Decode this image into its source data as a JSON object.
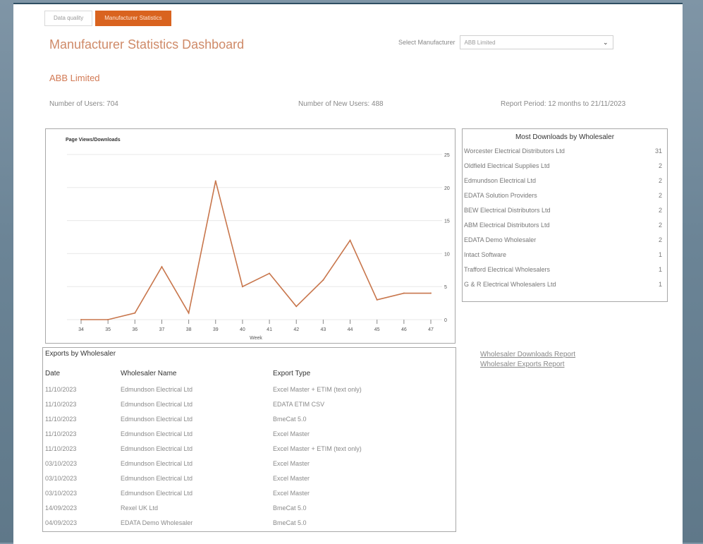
{
  "tabs": [
    {
      "label": "Data quality",
      "active": false
    },
    {
      "label": "Manufacturer Statistics",
      "active": true
    }
  ],
  "header": {
    "title": "Manufacturer Statistics Dashboard",
    "select_label": "Select Manufacturer",
    "select_value": "ABB Limited"
  },
  "manufacturer": "ABB Limited",
  "stats": {
    "users": "Number of Users: 704",
    "new_users": "Number of New Users: 488",
    "period": "Report Period: 12 months to 21/11/2023"
  },
  "chart_data": {
    "type": "line",
    "title": "Page Views/Downloads",
    "xlabel": "Week",
    "ylabel": "",
    "x": [
      "34",
      "35",
      "36",
      "37",
      "38",
      "39",
      "40",
      "41",
      "42",
      "43",
      "44",
      "45",
      "46",
      "47"
    ],
    "values": [
      0,
      0,
      1,
      8,
      1,
      21,
      5,
      7,
      2,
      6,
      12,
      3,
      4,
      4
    ],
    "ylim": [
      0,
      25
    ],
    "yticks": [
      0,
      5,
      10,
      15,
      20,
      25
    ],
    "y_axis_side": "right",
    "line_color": "#c8764c",
    "grid": true
  },
  "downloads": {
    "title": "Most Downloads by Wholesaler",
    "rows": [
      {
        "name": "Worcester Electrical Distributors Ltd",
        "count": "31"
      },
      {
        "name": "Oldfield Electrical Supplies Ltd",
        "count": "2"
      },
      {
        "name": "Edmundson Electrical Ltd",
        "count": "2"
      },
      {
        "name": "EDATA Solution Providers",
        "count": "2"
      },
      {
        "name": "BEW Electrical Distributors Ltd",
        "count": "2"
      },
      {
        "name": "ABM Electrical Distributors Ltd",
        "count": "2"
      },
      {
        "name": "EDATA Demo Wholesaler",
        "count": "2"
      },
      {
        "name": "Intact Software",
        "count": "1"
      },
      {
        "name": "Trafford Electrical Wholesalers",
        "count": "1"
      },
      {
        "name": "G & R Electrical Wholesalers Ltd",
        "count": "1"
      }
    ]
  },
  "exports": {
    "title": "Exports by Wholesaler",
    "headers": [
      "Date",
      "Wholesaler Name",
      "Export Type"
    ],
    "rows": [
      [
        "11/10/2023",
        "Edmundson Electrical Ltd",
        "Excel Master + ETIM (text only)"
      ],
      [
        "11/10/2023",
        "Edmundson Electrical Ltd",
        "EDATA ETIM CSV"
      ],
      [
        "11/10/2023",
        "Edmundson Electrical Ltd",
        "BmeCat 5.0"
      ],
      [
        "11/10/2023",
        "Edmundson Electrical Ltd",
        "Excel Master"
      ],
      [
        "11/10/2023",
        "Edmundson Electrical Ltd",
        "Excel Master + ETIM (text only)"
      ],
      [
        "03/10/2023",
        "Edmundson Electrical Ltd",
        "Excel Master"
      ],
      [
        "03/10/2023",
        "Edmundson Electrical Ltd",
        "Excel Master"
      ],
      [
        "03/10/2023",
        "Edmundson Electrical Ltd",
        "Excel Master"
      ],
      [
        "14/09/2023",
        "Rexel UK Ltd",
        "BmeCat 5.0"
      ],
      [
        "04/09/2023",
        "EDATA Demo Wholesaler",
        "BmeCat 5.0"
      ]
    ]
  },
  "links": [
    "Wholesaler Downloads Report",
    "Wholesaler Exports Report"
  ],
  "colors": {
    "accent": "#d9631f",
    "title": "#cf8a68"
  }
}
